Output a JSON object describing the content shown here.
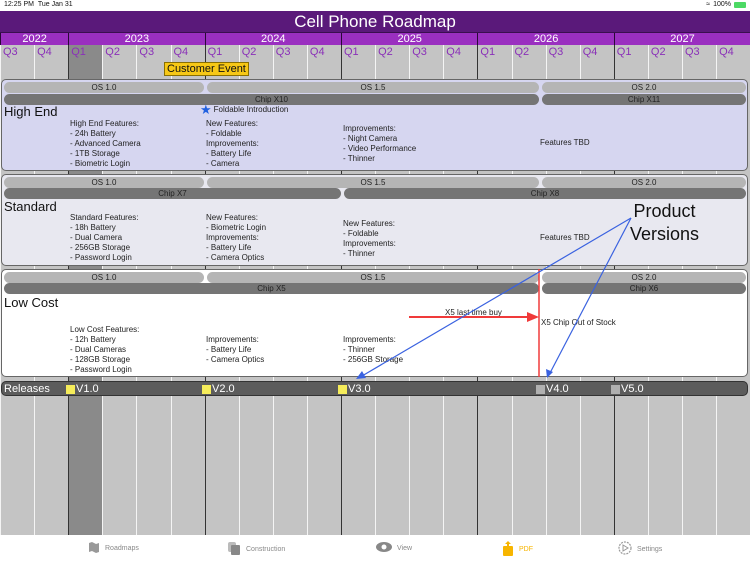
{
  "status_bar": {
    "time": "12:25 PM",
    "date": "Tue Jan 31",
    "battery": "100%",
    "wifi_icon": "wifi-icon"
  },
  "title": "Cell Phone Roadmap",
  "years": [
    "2022",
    "2023",
    "2024",
    "2025",
    "2026",
    "2027"
  ],
  "quarters": [
    "Q3",
    "Q4",
    "Q1",
    "Q2",
    "Q3",
    "Q4",
    "Q1",
    "Q2",
    "Q3",
    "Q4",
    "Q1",
    "Q2",
    "Q3",
    "Q4",
    "Q1",
    "Q2",
    "Q3",
    "Q4",
    "Q1",
    "Q2",
    "Q3",
    "Q4"
  ],
  "highlighted_quarter": "2023 Q1",
  "customer_event": "Customer Event",
  "lanes": [
    {
      "name": "High End",
      "os": [
        "OS 1.0",
        "OS 1.5",
        "OS 2.0"
      ],
      "chips": [
        "Chip X10",
        "Chip X11"
      ],
      "milestone": "Foldable Introduction",
      "notes": [
        "High End Features:\n- 24h Battery\n- Advanced Camera\n- 1TB Storage\n- Biometric Login",
        "New Features:\n- Foldable\nImprovements:\n- Battery Life\n- Camera",
        "Improvements:\n- Night Camera\n- Video Performance\n- Thinner",
        "Features TBD"
      ],
      "color": "#d6d6f0"
    },
    {
      "name": "Standard",
      "os": [
        "OS 1.0",
        "OS 1.5",
        "OS 2.0"
      ],
      "chips": [
        "Chip X7",
        "Chip X8"
      ],
      "notes": [
        "Standard Features:\n- 18h Battery\n- Dual Camera\n- 256GB Storage\n- Password Login",
        "New Features:\n- Biometric Login\nImprovements:\n- Battery Life\n- Camera Optics",
        "New Features:\n- Foldable\nImprovements:\n- Thinner",
        "Features TBD"
      ],
      "color": "#e8e8f0"
    },
    {
      "name": "Low Cost",
      "os": [
        "OS 1.0",
        "OS 1.5",
        "OS 2.0"
      ],
      "chips": [
        "Chip X5",
        "Chip X6"
      ],
      "notes": [
        "Low Cost Features:\n- 12h Battery\n- Dual Cameras\n- 128GB Storage\n- Password Login",
        "Improvements:\n- Battery Life\n- Camera Optics",
        "Improvements:\n- Thinner\n- 256GB Storage"
      ],
      "annotations": {
        "last_buy": "X5 last time buy",
        "out_of_stock": "X5 Chip Out of Stock"
      },
      "color": "#ffffff"
    }
  ],
  "releases": {
    "label": "Releases",
    "items": [
      {
        "label": "V1.0",
        "color": "#f5ec5a"
      },
      {
        "label": "V2.0",
        "color": "#f5ec5a"
      },
      {
        "label": "V3.0",
        "color": "#f5ec5a"
      },
      {
        "label": "V4.0",
        "color": "#b0b0b0"
      },
      {
        "label": "V5.0",
        "color": "#b0b0b0"
      }
    ]
  },
  "callout": {
    "line1": "Product",
    "line2": "Versions"
  },
  "tabs": [
    {
      "label": "Roadmaps",
      "icon": "map-icon"
    },
    {
      "label": "Construction",
      "icon": "construction-icon"
    },
    {
      "label": "View",
      "icon": "eye-icon"
    },
    {
      "label": "PDF",
      "icon": "share-icon",
      "active": true
    },
    {
      "label": "Settings",
      "icon": "gear-icon"
    }
  ],
  "colors": {
    "title_bg": "#5a197a",
    "year_bg": "#9a2fc0",
    "quarter_text": "#8a30b8",
    "accent": "#f7b500"
  }
}
